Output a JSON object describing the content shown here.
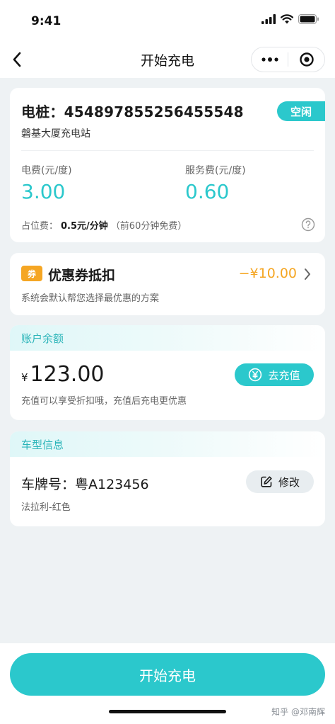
{
  "status_bar": {
    "time": "9:41"
  },
  "nav": {
    "title": "开始充电"
  },
  "pile": {
    "id_label": "电桩：4548978552564555​48",
    "status": "空闲",
    "station": "磐基大厦充电站",
    "electric_fee_label": "电费(元/度)",
    "electric_fee_value": "3.00",
    "service_fee_label": "服务费(元/度)",
    "service_fee_value": "0.60",
    "occupy_label": "占位费：",
    "occupy_value": "0.5元/分钟",
    "occupy_note": "（前60分钟免费）"
  },
  "coupon": {
    "tag": "券",
    "title": "优惠券抵扣",
    "amount": "−¥10.00",
    "desc": "系统会默认帮您选择最优惠的方案"
  },
  "balance": {
    "section_title": "账户余额",
    "currency": "¥",
    "amount": "123.00",
    "recharge_label": "去充值",
    "tip": "充值可以享受折扣哦，充值后充电更优惠"
  },
  "car": {
    "section_title": "车型信息",
    "plate": "车牌号：粤A123456",
    "modify_label": "修改",
    "desc": "法拉利-红色"
  },
  "footer": {
    "start_label": "开始充电",
    "watermark": "知乎 @邓南辉"
  },
  "colors": {
    "accent": "#2bc8cc",
    "coupon": "#f5a623"
  }
}
